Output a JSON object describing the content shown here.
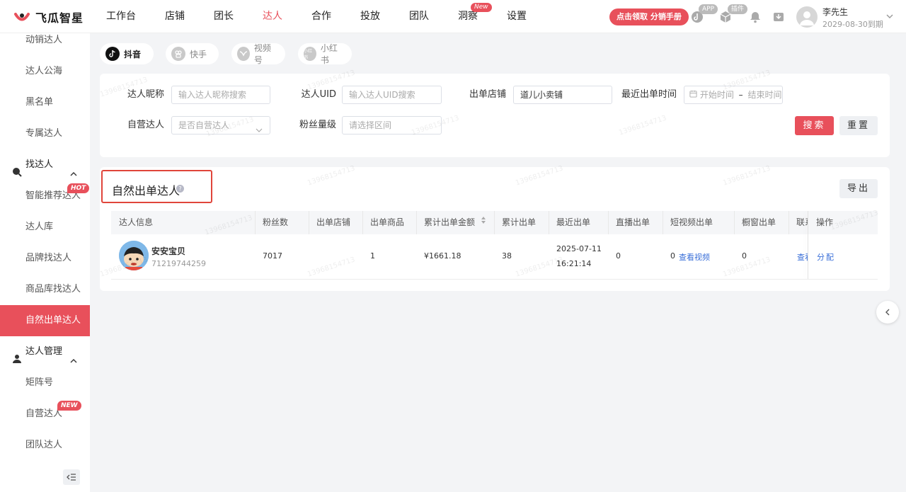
{
  "app": {
    "logo_text": "飞瓜智星",
    "brand_color": "#e8505b"
  },
  "nav": {
    "items": [
      {
        "label": "工作台"
      },
      {
        "label": "店铺"
      },
      {
        "label": "团长"
      },
      {
        "label": "达人",
        "active": true
      },
      {
        "label": "合作"
      },
      {
        "label": "投放"
      },
      {
        "label": "团队"
      },
      {
        "label": "洞察",
        "badge": "New"
      },
      {
        "label": "设置"
      }
    ],
    "promo_label": "点击领取 分销手册",
    "app_tag": "APP",
    "plugin_tag": "插件",
    "user_name": "李先生",
    "user_expiry": "2029-08-30到期"
  },
  "sidebar": {
    "items_top": [
      "动销达人",
      "达人公海",
      "黑名单",
      "专属达人"
    ],
    "group_find": "找达人",
    "find_items": [
      "智能推荐达人",
      "达人库",
      "品牌找达人",
      "商品库找达人",
      "自然出单达人"
    ],
    "find_hot_badge": "HOT",
    "group_manage": "达人管理",
    "manage_items": [
      "矩阵号",
      "自营达人",
      "团队达人"
    ],
    "manage_new_badge": "NEW",
    "active_item": "自然出单达人"
  },
  "platform_tabs": [
    {
      "label": "抖音",
      "active": true,
      "icon": "douyin-icon"
    },
    {
      "label": "快手",
      "icon": "kuaishou-icon"
    },
    {
      "label": "视频号",
      "icon": "channels-icon"
    },
    {
      "label": "小红书",
      "icon": "xiaohongshu-icon",
      "icon_text": "小红书"
    }
  ],
  "filters": {
    "nickname_label": "达人昵称",
    "nickname_placeholder": "输入达人昵称搜索",
    "uid_label": "达人UID",
    "uid_placeholder": "输入达人UID搜索",
    "shop_label": "出单店铺",
    "shop_value": "道儿小卖铺",
    "time_label": "最近出单时间",
    "time_start_placeholder": "开始时间",
    "time_separator": "–",
    "time_end_placeholder": "结束时间",
    "self_label": "自营达人",
    "self_placeholder": "是否自营达人",
    "fans_label": "粉丝量级",
    "fans_placeholder": "请选择区间",
    "search_label": "搜索",
    "reset_label": "重置"
  },
  "section": {
    "title": "自然出单达人",
    "export_label": "导出"
  },
  "table": {
    "headers": [
      "达人信息",
      "粉丝数",
      "出单店铺",
      "出单商品",
      "累计出单金额",
      "累计出单",
      "最近出单",
      "直播出单",
      "短视频出单",
      "橱窗出单",
      "联系",
      "操作"
    ],
    "rows": [
      {
        "name": "安安宝贝",
        "uid": "71219744259",
        "fans": "7017",
        "shop": "",
        "products": "1",
        "amount": "¥1661.18",
        "orders": "38",
        "last_date": "2025-07-11",
        "last_time": "16:21:14",
        "live": "0",
        "video": "0",
        "video_link": "查看视频",
        "window": "0",
        "contact": "查看",
        "action": "分配"
      }
    ]
  },
  "watermark": "13968154713"
}
